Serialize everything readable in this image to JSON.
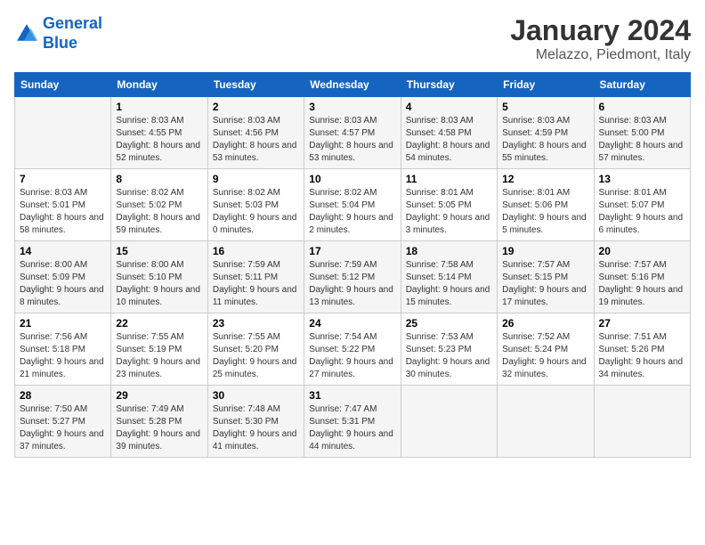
{
  "header": {
    "logo_general": "General",
    "logo_blue": "Blue",
    "month_title": "January 2024",
    "location": "Melazzo, Piedmont, Italy"
  },
  "weekdays": [
    "Sunday",
    "Monday",
    "Tuesday",
    "Wednesday",
    "Thursday",
    "Friday",
    "Saturday"
  ],
  "weeks": [
    [
      {
        "day": "",
        "sunrise": "",
        "sunset": "",
        "daylight": ""
      },
      {
        "day": "1",
        "sunrise": "Sunrise: 8:03 AM",
        "sunset": "Sunset: 4:55 PM",
        "daylight": "Daylight: 8 hours and 52 minutes."
      },
      {
        "day": "2",
        "sunrise": "Sunrise: 8:03 AM",
        "sunset": "Sunset: 4:56 PM",
        "daylight": "Daylight: 8 hours and 53 minutes."
      },
      {
        "day": "3",
        "sunrise": "Sunrise: 8:03 AM",
        "sunset": "Sunset: 4:57 PM",
        "daylight": "Daylight: 8 hours and 53 minutes."
      },
      {
        "day": "4",
        "sunrise": "Sunrise: 8:03 AM",
        "sunset": "Sunset: 4:58 PM",
        "daylight": "Daylight: 8 hours and 54 minutes."
      },
      {
        "day": "5",
        "sunrise": "Sunrise: 8:03 AM",
        "sunset": "Sunset: 4:59 PM",
        "daylight": "Daylight: 8 hours and 55 minutes."
      },
      {
        "day": "6",
        "sunrise": "Sunrise: 8:03 AM",
        "sunset": "Sunset: 5:00 PM",
        "daylight": "Daylight: 8 hours and 57 minutes."
      }
    ],
    [
      {
        "day": "7",
        "sunrise": "Sunrise: 8:03 AM",
        "sunset": "Sunset: 5:01 PM",
        "daylight": "Daylight: 8 hours and 58 minutes."
      },
      {
        "day": "8",
        "sunrise": "Sunrise: 8:02 AM",
        "sunset": "Sunset: 5:02 PM",
        "daylight": "Daylight: 8 hours and 59 minutes."
      },
      {
        "day": "9",
        "sunrise": "Sunrise: 8:02 AM",
        "sunset": "Sunset: 5:03 PM",
        "daylight": "Daylight: 9 hours and 0 minutes."
      },
      {
        "day": "10",
        "sunrise": "Sunrise: 8:02 AM",
        "sunset": "Sunset: 5:04 PM",
        "daylight": "Daylight: 9 hours and 2 minutes."
      },
      {
        "day": "11",
        "sunrise": "Sunrise: 8:01 AM",
        "sunset": "Sunset: 5:05 PM",
        "daylight": "Daylight: 9 hours and 3 minutes."
      },
      {
        "day": "12",
        "sunrise": "Sunrise: 8:01 AM",
        "sunset": "Sunset: 5:06 PM",
        "daylight": "Daylight: 9 hours and 5 minutes."
      },
      {
        "day": "13",
        "sunrise": "Sunrise: 8:01 AM",
        "sunset": "Sunset: 5:07 PM",
        "daylight": "Daylight: 9 hours and 6 minutes."
      }
    ],
    [
      {
        "day": "14",
        "sunrise": "Sunrise: 8:00 AM",
        "sunset": "Sunset: 5:09 PM",
        "daylight": "Daylight: 9 hours and 8 minutes."
      },
      {
        "day": "15",
        "sunrise": "Sunrise: 8:00 AM",
        "sunset": "Sunset: 5:10 PM",
        "daylight": "Daylight: 9 hours and 10 minutes."
      },
      {
        "day": "16",
        "sunrise": "Sunrise: 7:59 AM",
        "sunset": "Sunset: 5:11 PM",
        "daylight": "Daylight: 9 hours and 11 minutes."
      },
      {
        "day": "17",
        "sunrise": "Sunrise: 7:59 AM",
        "sunset": "Sunset: 5:12 PM",
        "daylight": "Daylight: 9 hours and 13 minutes."
      },
      {
        "day": "18",
        "sunrise": "Sunrise: 7:58 AM",
        "sunset": "Sunset: 5:14 PM",
        "daylight": "Daylight: 9 hours and 15 minutes."
      },
      {
        "day": "19",
        "sunrise": "Sunrise: 7:57 AM",
        "sunset": "Sunset: 5:15 PM",
        "daylight": "Daylight: 9 hours and 17 minutes."
      },
      {
        "day": "20",
        "sunrise": "Sunrise: 7:57 AM",
        "sunset": "Sunset: 5:16 PM",
        "daylight": "Daylight: 9 hours and 19 minutes."
      }
    ],
    [
      {
        "day": "21",
        "sunrise": "Sunrise: 7:56 AM",
        "sunset": "Sunset: 5:18 PM",
        "daylight": "Daylight: 9 hours and 21 minutes."
      },
      {
        "day": "22",
        "sunrise": "Sunrise: 7:55 AM",
        "sunset": "Sunset: 5:19 PM",
        "daylight": "Daylight: 9 hours and 23 minutes."
      },
      {
        "day": "23",
        "sunrise": "Sunrise: 7:55 AM",
        "sunset": "Sunset: 5:20 PM",
        "daylight": "Daylight: 9 hours and 25 minutes."
      },
      {
        "day": "24",
        "sunrise": "Sunrise: 7:54 AM",
        "sunset": "Sunset: 5:22 PM",
        "daylight": "Daylight: 9 hours and 27 minutes."
      },
      {
        "day": "25",
        "sunrise": "Sunrise: 7:53 AM",
        "sunset": "Sunset: 5:23 PM",
        "daylight": "Daylight: 9 hours and 30 minutes."
      },
      {
        "day": "26",
        "sunrise": "Sunrise: 7:52 AM",
        "sunset": "Sunset: 5:24 PM",
        "daylight": "Daylight: 9 hours and 32 minutes."
      },
      {
        "day": "27",
        "sunrise": "Sunrise: 7:51 AM",
        "sunset": "Sunset: 5:26 PM",
        "daylight": "Daylight: 9 hours and 34 minutes."
      }
    ],
    [
      {
        "day": "28",
        "sunrise": "Sunrise: 7:50 AM",
        "sunset": "Sunset: 5:27 PM",
        "daylight": "Daylight: 9 hours and 37 minutes."
      },
      {
        "day": "29",
        "sunrise": "Sunrise: 7:49 AM",
        "sunset": "Sunset: 5:28 PM",
        "daylight": "Daylight: 9 hours and 39 minutes."
      },
      {
        "day": "30",
        "sunrise": "Sunrise: 7:48 AM",
        "sunset": "Sunset: 5:30 PM",
        "daylight": "Daylight: 9 hours and 41 minutes."
      },
      {
        "day": "31",
        "sunrise": "Sunrise: 7:47 AM",
        "sunset": "Sunset: 5:31 PM",
        "daylight": "Daylight: 9 hours and 44 minutes."
      },
      {
        "day": "",
        "sunrise": "",
        "sunset": "",
        "daylight": ""
      },
      {
        "day": "",
        "sunrise": "",
        "sunset": "",
        "daylight": ""
      },
      {
        "day": "",
        "sunrise": "",
        "sunset": "",
        "daylight": ""
      }
    ]
  ]
}
